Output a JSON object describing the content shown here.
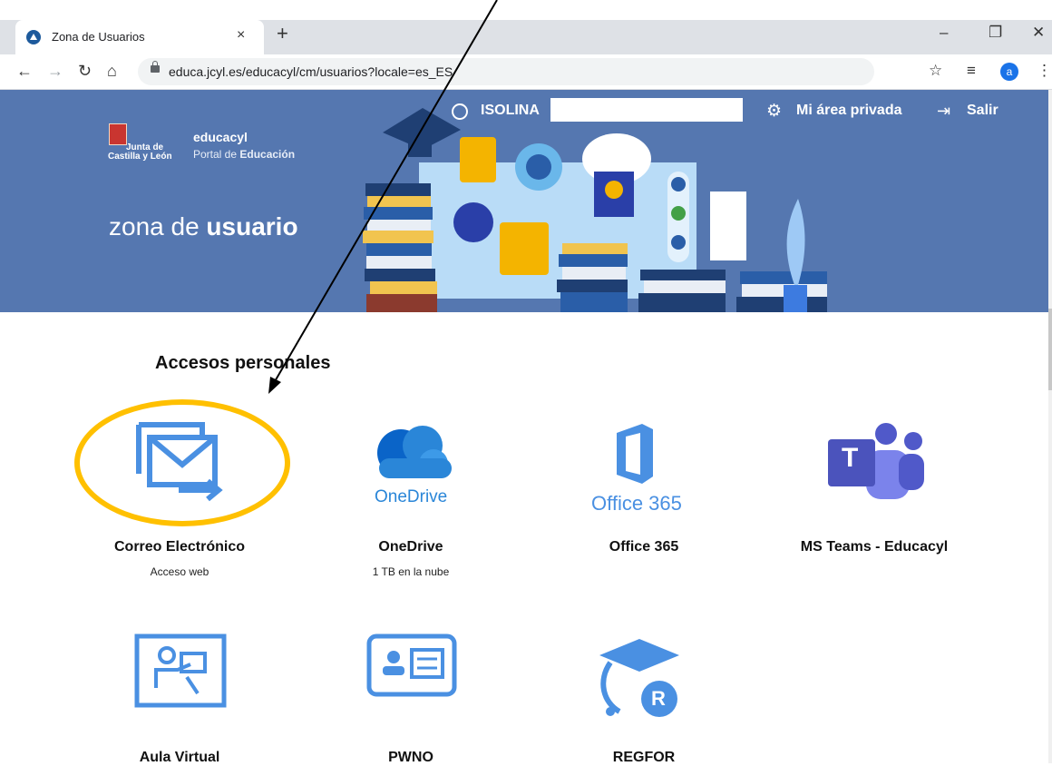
{
  "browser": {
    "tab_title": "Zona de Usuarios",
    "tab_close": "×",
    "new_tab": "+",
    "url": "educa.jcyl.es/educacyl/cm/usuarios?locale=es_ES",
    "profile_initial": "a"
  },
  "header": {
    "org_line1": "Junta de",
    "org_line2": "Castilla y León",
    "site_name": "educacyl",
    "portal_prefix": "Portal de ",
    "portal_bold": "Educación",
    "zona_prefix": "zona de ",
    "zona_bold": "usuario",
    "username": "ISOLINA",
    "private_area": "Mi área privada",
    "logout": "Salir"
  },
  "main": {
    "section_title": "Accesos personales",
    "tiles": [
      {
        "label": "Correo Electrónico",
        "sub": "Acceso web",
        "icon": "mail-forward-icon"
      },
      {
        "label": "OneDrive",
        "sub": "1 TB en la nube",
        "icon": "onedrive-icon",
        "icon_text": "OneDrive"
      },
      {
        "label": "Office 365",
        "sub": "",
        "icon": "office365-icon",
        "icon_text": "Office 365"
      },
      {
        "label": "MS Teams - Educacyl",
        "sub": "",
        "icon": "teams-icon",
        "icon_text": "T"
      },
      {
        "label": "Aula Virtual",
        "sub": "",
        "icon": "classroom-icon"
      },
      {
        "label": "PWNO",
        "sub": "",
        "icon": "id-card-icon"
      },
      {
        "label": "REGFOR",
        "sub": "",
        "icon": "graduation-r-icon",
        "icon_text": "R"
      }
    ]
  },
  "colors": {
    "banner": "#5577b0",
    "icon_blue": "#4a90e2",
    "highlight": "#ffc000",
    "teams_purple": "#5059c9"
  }
}
